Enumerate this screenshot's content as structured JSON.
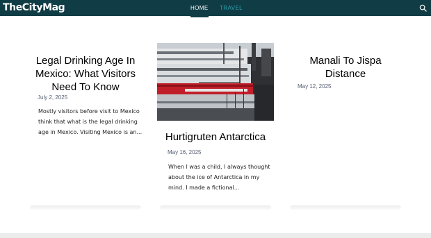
{
  "header": {
    "logo": "TheCityMag",
    "nav": [
      {
        "label": "HOME",
        "active": true
      },
      {
        "label": "TRAVEL",
        "active": false
      }
    ],
    "search_icon": "search-icon"
  },
  "posts": [
    {
      "title": "Legal Drinking Age In Mexico: What Visitors Need To Know",
      "date": "July 2, 2025",
      "excerpt": "Mostly visitors before visit to Mexico think that what is the legal drinking age in Mexico. Visiting Mexico is an..."
    },
    {
      "title": "Hurtigruten Antarctica",
      "date": "May 16, 2025",
      "excerpt": "When I was a child, I always thought about the ice of Antarctica in my mind. I made a fictional..."
    },
    {
      "title": "Manali To Jispa Distance",
      "date": "May 12, 2025",
      "excerpt": ""
    }
  ],
  "colors": {
    "header_bg": "#103c45",
    "nav_inactive": "#2aa8b4",
    "date": "#555e72"
  }
}
